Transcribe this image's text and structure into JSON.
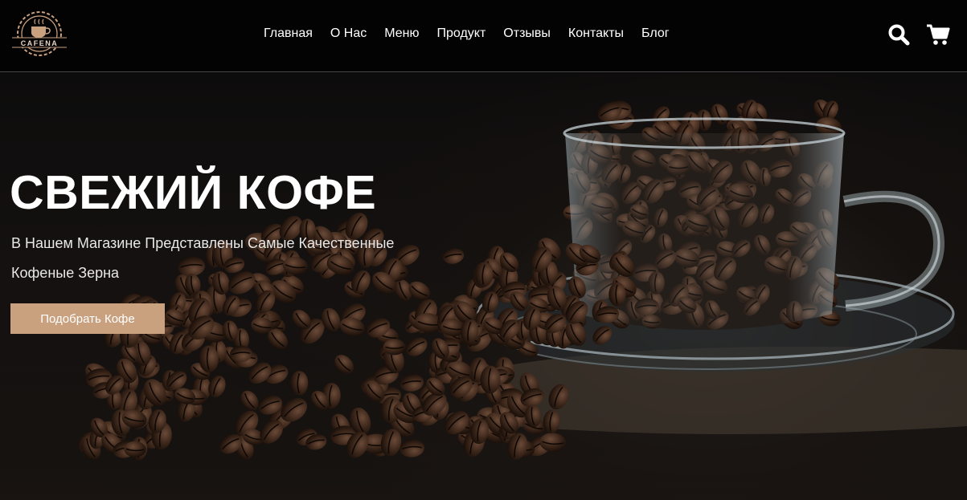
{
  "header": {
    "logo_text": "CAFENA",
    "nav": [
      "Главная",
      "О Нас",
      "Меню",
      "Продукт",
      "Отзывы",
      "Контакты",
      "Блог"
    ],
    "icons": [
      "search-icon",
      "cart-icon"
    ]
  },
  "hero": {
    "title": "СВЕЖИЙ КОФЕ",
    "subtitle_line1": "В Нашем Магазине Представлены Самые Качественные",
    "subtitle_line2": "Кофеные Зерна",
    "cta_label": "Подобрать Кофе",
    "image": "coffee-beans-in-glass-cup"
  },
  "colors": {
    "header_bg": "#030304",
    "accent": "#c9a17f",
    "text": "#ffffff"
  }
}
